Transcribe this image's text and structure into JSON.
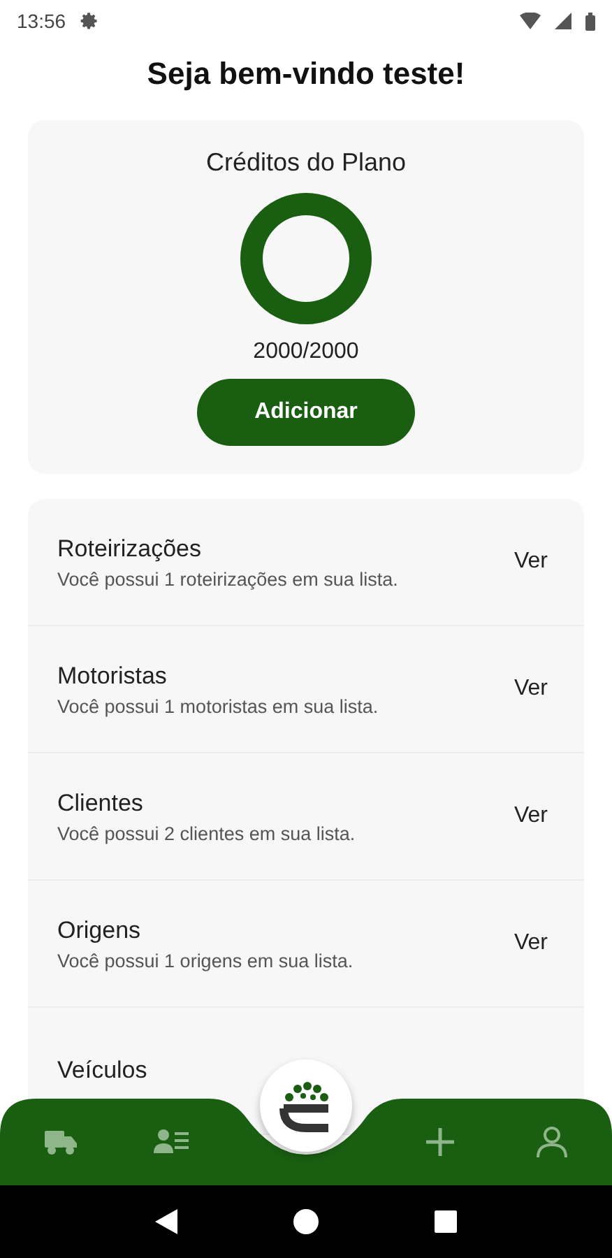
{
  "status_bar": {
    "time": "13:56"
  },
  "title": "Seja bem-vindo teste!",
  "credits": {
    "title": "Créditos do Plano",
    "level": 1,
    "reading": "2000/2000",
    "button": "Adicionar"
  },
  "items": [
    {
      "title": "Roteirizações",
      "subtitle": "Você possui 1 roteirizações em sua lista.",
      "action": "Ver"
    },
    {
      "title": "Motoristas",
      "subtitle": "Você possui 1 motoristas em sua lista.",
      "action": "Ver"
    },
    {
      "title": "Clientes",
      "subtitle": "Você possui 2 clientes em sua lista.",
      "action": "Ver"
    },
    {
      "title": "Origens",
      "subtitle": "Você possui 1 origens em sua lista.",
      "action": "Ver"
    },
    {
      "title": "Veículos"
    }
  ]
}
